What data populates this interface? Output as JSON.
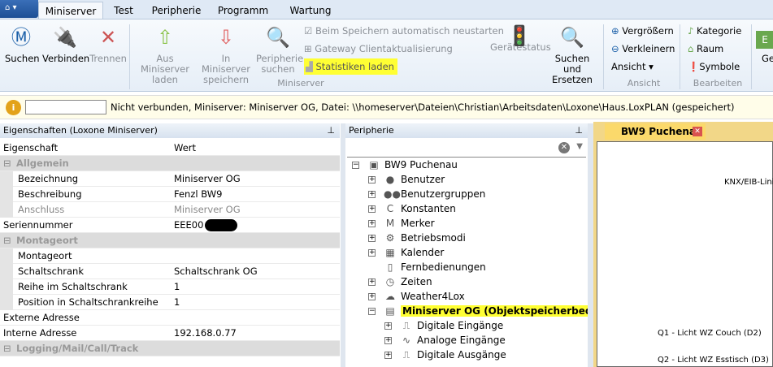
{
  "ribbon": {
    "tabs": [
      "Miniserver",
      "Test",
      "Peripherie",
      "Programm",
      "Wartung"
    ],
    "buttons": {
      "suchen": "Suchen",
      "verbinden": "Verbinden",
      "trennen": "Trennen",
      "aus1": "Aus Miniserver",
      "aus2": "laden",
      "in1": "In Miniserver",
      "in2": "speichern",
      "per1": "Peripherie",
      "per2": "suchen",
      "geraet": "Gerätestatus",
      "sr1": "Suchen und",
      "sr2": "Ersetzen",
      "ge": "Ge"
    },
    "checks": {
      "autorestart": "Beim Speichern automatisch neustarten",
      "gateway": "Gateway Clientaktualisierung",
      "stats": "Statistiken laden"
    },
    "ansicht": {
      "zoomin": "Vergrößern",
      "zoomout": "Verkleinern",
      "view": "Ansicht"
    },
    "bearbeiten": {
      "kategorie": "Kategorie",
      "raum": "Raum",
      "symbole": "Symbole"
    },
    "groups": {
      "miniserver": "Miniserver",
      "ansicht": "Ansicht",
      "bearbeiten": "Bearbeiten"
    },
    "highlight": "#ffff33"
  },
  "infobar": {
    "message": "Nicht verbunden, Miniserver: Miniserver OG, Datei: \\\\homeserver\\Dateien\\Christian\\Arbeitsdaten\\Loxone\\Haus.LoxPLAN (gespeichert)",
    "input_value": ""
  },
  "properties": {
    "title": "Eigenschaften (Loxone Miniserver)",
    "col_key": "Eigenschaft",
    "col_val": "Wert",
    "rows": [
      {
        "k": "Allgemein",
        "v": "",
        "type": "cat"
      },
      {
        "k": "Bezeichnung",
        "v": "Miniserver OG",
        "type": "ind"
      },
      {
        "k": "Beschreibung",
        "v": "Fenzl BW9",
        "type": "ind"
      },
      {
        "k": "Anschluss",
        "v": "Miniserver OG",
        "type": "ind dis"
      },
      {
        "k": "Seriennummer",
        "v": "EEE00",
        "type": ""
      },
      {
        "k": "Montageort",
        "v": "",
        "type": "cat"
      },
      {
        "k": "Montageort",
        "v": "",
        "type": "ind"
      },
      {
        "k": "Schaltschrank",
        "v": "Schaltschrank OG",
        "type": "ind"
      },
      {
        "k": "Reihe im Schaltschrank",
        "v": "1",
        "type": "ind"
      },
      {
        "k": "Position in Schaltschrankreihe",
        "v": "1",
        "type": "ind"
      },
      {
        "k": "Externe Adresse",
        "v": "",
        "type": ""
      },
      {
        "k": "Interne Adresse",
        "v": "192.168.0.77",
        "type": ""
      },
      {
        "k": "Logging/Mail/Call/Track",
        "v": "",
        "type": "cat"
      }
    ]
  },
  "peripherie": {
    "title": "Peripherie",
    "search_value": "",
    "tree": [
      {
        "label": "BW9 Puchenau",
        "level": 0,
        "toggle": "−",
        "icon": "▣"
      },
      {
        "label": "Benutzer",
        "level": 1,
        "toggle": "+",
        "icon": "●"
      },
      {
        "label": "Benutzergruppen",
        "level": 1,
        "toggle": "+",
        "icon": "●●"
      },
      {
        "label": "Konstanten",
        "level": 1,
        "toggle": "+",
        "icon": "C"
      },
      {
        "label": "Merker",
        "level": 1,
        "toggle": "+",
        "icon": "M"
      },
      {
        "label": "Betriebsmodi",
        "level": 1,
        "toggle": "+",
        "icon": "⚙"
      },
      {
        "label": "Kalender",
        "level": 1,
        "toggle": "+",
        "icon": "▦"
      },
      {
        "label": "Fernbedienungen",
        "level": 1,
        "toggle": "",
        "icon": "▯"
      },
      {
        "label": "Zeiten",
        "level": 1,
        "toggle": "+",
        "icon": "◷"
      },
      {
        "label": "Weather4Lox",
        "level": 1,
        "toggle": "+",
        "icon": "☁"
      },
      {
        "label": "Miniserver OG (Objektspeicherbedarf gesamt)",
        "level": 1,
        "toggle": "−",
        "icon": "▤",
        "bold": true
      },
      {
        "label": "Digitale Eingänge",
        "level": 2,
        "toggle": "+",
        "icon": "⎍"
      },
      {
        "label": "Analoge Eingänge",
        "level": 2,
        "toggle": "+",
        "icon": "∿"
      },
      {
        "label": "Digitale Ausgänge",
        "level": 2,
        "toggle": "+",
        "icon": "⎍"
      }
    ]
  },
  "document": {
    "tab": "BW9 Puchenau",
    "labels": [
      "KNX/EIB-Linie",
      "Q1 - Licht WZ Couch (D2)",
      "Q2 - Licht WZ Esstisch (D3)"
    ]
  }
}
